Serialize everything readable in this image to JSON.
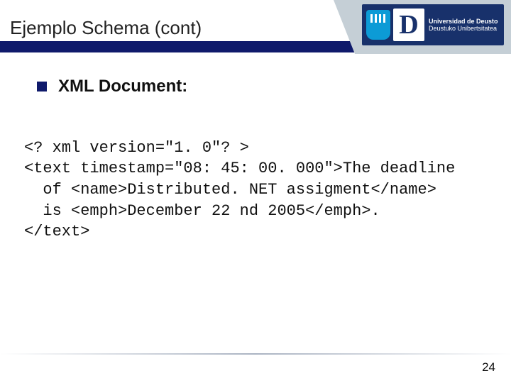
{
  "header": {
    "title": "Ejemplo Schema (cont)",
    "university": {
      "line1": "Universidad de Deusto",
      "line2": "Deustuko Unibertsitatea",
      "letter": "D"
    }
  },
  "content": {
    "bullet_heading": "XML Document:",
    "code_lines": [
      "<? xml version=\"1. 0\"? >",
      "<text timestamp=\"08: 45: 00. 000\">The deadline",
      "  of <name>Distributed. NET assigment</name>",
      "  is <emph>December 22 nd 2005</emph>.",
      "</text>"
    ]
  },
  "footer": {
    "page_number": "24"
  }
}
